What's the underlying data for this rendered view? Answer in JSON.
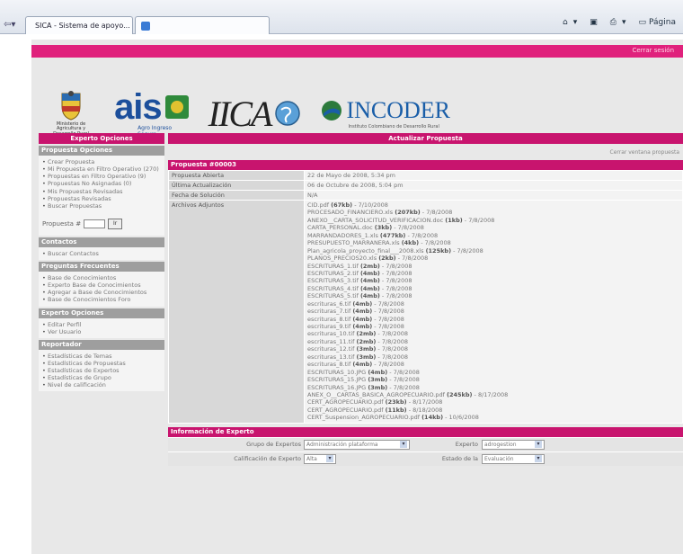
{
  "browser": {
    "tabs": [
      {
        "label": "SICA - Sistema de apoyo...",
        "active": true
      },
      {
        "label": "",
        "active": false
      }
    ],
    "commands": {
      "home": "",
      "print": "",
      "page": "Página"
    }
  },
  "header": {
    "right_link": "Cerrar sesión"
  },
  "logos": {
    "gob_caption": "Ministerio de Agricultura y Desarrollo Rural",
    "ais_word": "ais",
    "ais_caption": "Agro Ingreso Seguro",
    "iica_word": "IICA",
    "incoder_word": "INCODER",
    "incoder_caption": "Instituto Colombiano de Desarrollo Rural"
  },
  "sidebar": {
    "title": "Experto Opciones",
    "sections": [
      {
        "title": "Propuesta Opciones",
        "items": [
          "Crear Propuesta",
          "Mi Propuesta en Filtro Operativo (270)",
          "Propuestas en Filtro Operativo (9)",
          "Propuestas No Asignadas (0)",
          "Mis Propuestas Revisadas",
          "Propuestas Revisadas",
          "Buscar Propuestas"
        ]
      },
      {
        "title": "Contactos",
        "items": [
          "Buscar Contactos"
        ]
      },
      {
        "title": "Preguntas Frecuentes",
        "items": [
          "Base de Conocimientos",
          "Experto Base de Conocimientos",
          "Agregar a Base de Conocimientos",
          "Base de Conocimientos Foro"
        ]
      },
      {
        "title": "Experto Opciones",
        "items": [
          "Editar Perfil",
          "Ver Usuario"
        ]
      },
      {
        "title": "Reportador",
        "items": [
          "Estadísticas de Temas",
          "Estadísticas de Propuestas",
          "Estadísticas de Expertos",
          "Estadísticas de Grupo",
          "Nivel de calificación"
        ]
      }
    ],
    "proposal_label": "Propuesta #",
    "proposal_value": "",
    "go_label": "Ir"
  },
  "main": {
    "title": "Actualizar Propuesta",
    "top_link": "Cerrar ventana propuesta",
    "proposal_title": "Propuesta #00003",
    "rows": [
      {
        "key": "Propuesta Abierta",
        "value": "22 de Mayo de 2008, 5:34 pm"
      },
      {
        "key": "Última Actualización",
        "value": "06 de Octubre de 2008, 5:04 pm"
      },
      {
        "key": "Fecha de Solución",
        "value": "N/A"
      }
    ],
    "attachments_key": "Archivos Adjuntos",
    "attachments": [
      {
        "name": "CID.pdf",
        "size": "(67kb)",
        "date": "7/10/2008"
      },
      {
        "name": "PROCESADO_FINANCIERO.xls",
        "size": "(207kb)",
        "date": "7/8/2008"
      },
      {
        "name": "ANEXO__CARTA_SOLICITUD_VERIFICACION.doc",
        "size": "(1kb)",
        "date": "7/8/2008"
      },
      {
        "name": "CARTA_PERSONAL.doc",
        "size": "(3kb)",
        "date": "7/8/2008"
      },
      {
        "name": "MARRANDADORES_1.xls",
        "size": "(477kb)",
        "date": "7/8/2008"
      },
      {
        "name": "PRESUPUESTO_MARRANERA.xls",
        "size": "(4kb)",
        "date": "7/8/2008"
      },
      {
        "name": "Plan_agricola_proyecto_final___2008.xls",
        "size": "(125kb)",
        "date": "7/8/2008"
      },
      {
        "name": "PLANOS_PRECIOS20.xls",
        "size": "(2kb)",
        "date": "7/8/2008"
      },
      {
        "name": "ESCRITURAS_1.tif",
        "size": "(2mb)",
        "date": "7/8/2008"
      },
      {
        "name": "ESCRITURAS_2.tif",
        "size": "(4mb)",
        "date": "7/8/2008"
      },
      {
        "name": "ESCRITURAS_3.tif",
        "size": "(4mb)",
        "date": "7/8/2008"
      },
      {
        "name": "ESCRITURAS_4.tif",
        "size": "(4mb)",
        "date": "7/8/2008"
      },
      {
        "name": "ESCRITURAS_5.tif",
        "size": "(4mb)",
        "date": "7/8/2008"
      },
      {
        "name": "escrituras_6.tif",
        "size": "(4mb)",
        "date": "7/8/2008"
      },
      {
        "name": "escrituras_7.tif",
        "size": "(4mb)",
        "date": "7/8/2008"
      },
      {
        "name": "escrituras_8.tif",
        "size": "(4mb)",
        "date": "7/8/2008"
      },
      {
        "name": "escrituras_9.tif",
        "size": "(4mb)",
        "date": "7/8/2008"
      },
      {
        "name": "escrituras_10.tif",
        "size": "(2mb)",
        "date": "7/8/2008"
      },
      {
        "name": "escrituras_11.tif",
        "size": "(2mb)",
        "date": "7/8/2008"
      },
      {
        "name": "escrituras_12.tif",
        "size": "(3mb)",
        "date": "7/8/2008"
      },
      {
        "name": "escrituras_13.tif",
        "size": "(3mb)",
        "date": "7/8/2008"
      },
      {
        "name": "escrituras_8.tif",
        "size": "(4mb)",
        "date": "7/8/2008"
      },
      {
        "name": "ESCRITURAS_10.JPG",
        "size": "(4mb)",
        "date": "7/8/2008"
      },
      {
        "name": "ESCRITURAS_15.JPG",
        "size": "(3mb)",
        "date": "7/8/2008"
      },
      {
        "name": "ESCRITURAS_16.JPG",
        "size": "(3mb)",
        "date": "7/8/2008"
      },
      {
        "name": "ANEX_O__CARTAS_BASICA_AGROPECUARIO.pdf",
        "size": "(245kb)",
        "date": "8/17/2008"
      },
      {
        "name": "CERT_AGROPECUARIO.pdf",
        "size": "(23kb)",
        "date": "8/17/2008"
      },
      {
        "name": "CERT_AGROPECUARIO.pdf",
        "size": "(11kb)",
        "date": "8/18/2008"
      },
      {
        "name": "CERT_Suspension_AGROPECUARIO.pdf",
        "size": "(14kb)",
        "date": "10/6/2008"
      }
    ],
    "expert_section_title": "Información de Experto",
    "expert_rows": [
      {
        "k1": "Grupo de Expertos",
        "v1": "Administración plataforma",
        "k2": "Experto",
        "v2": "adrogestion"
      },
      {
        "k1": "Calificación de Experto",
        "v1": "Alta",
        "k2": "Estado de la",
        "v2": "Evaluación"
      }
    ]
  }
}
